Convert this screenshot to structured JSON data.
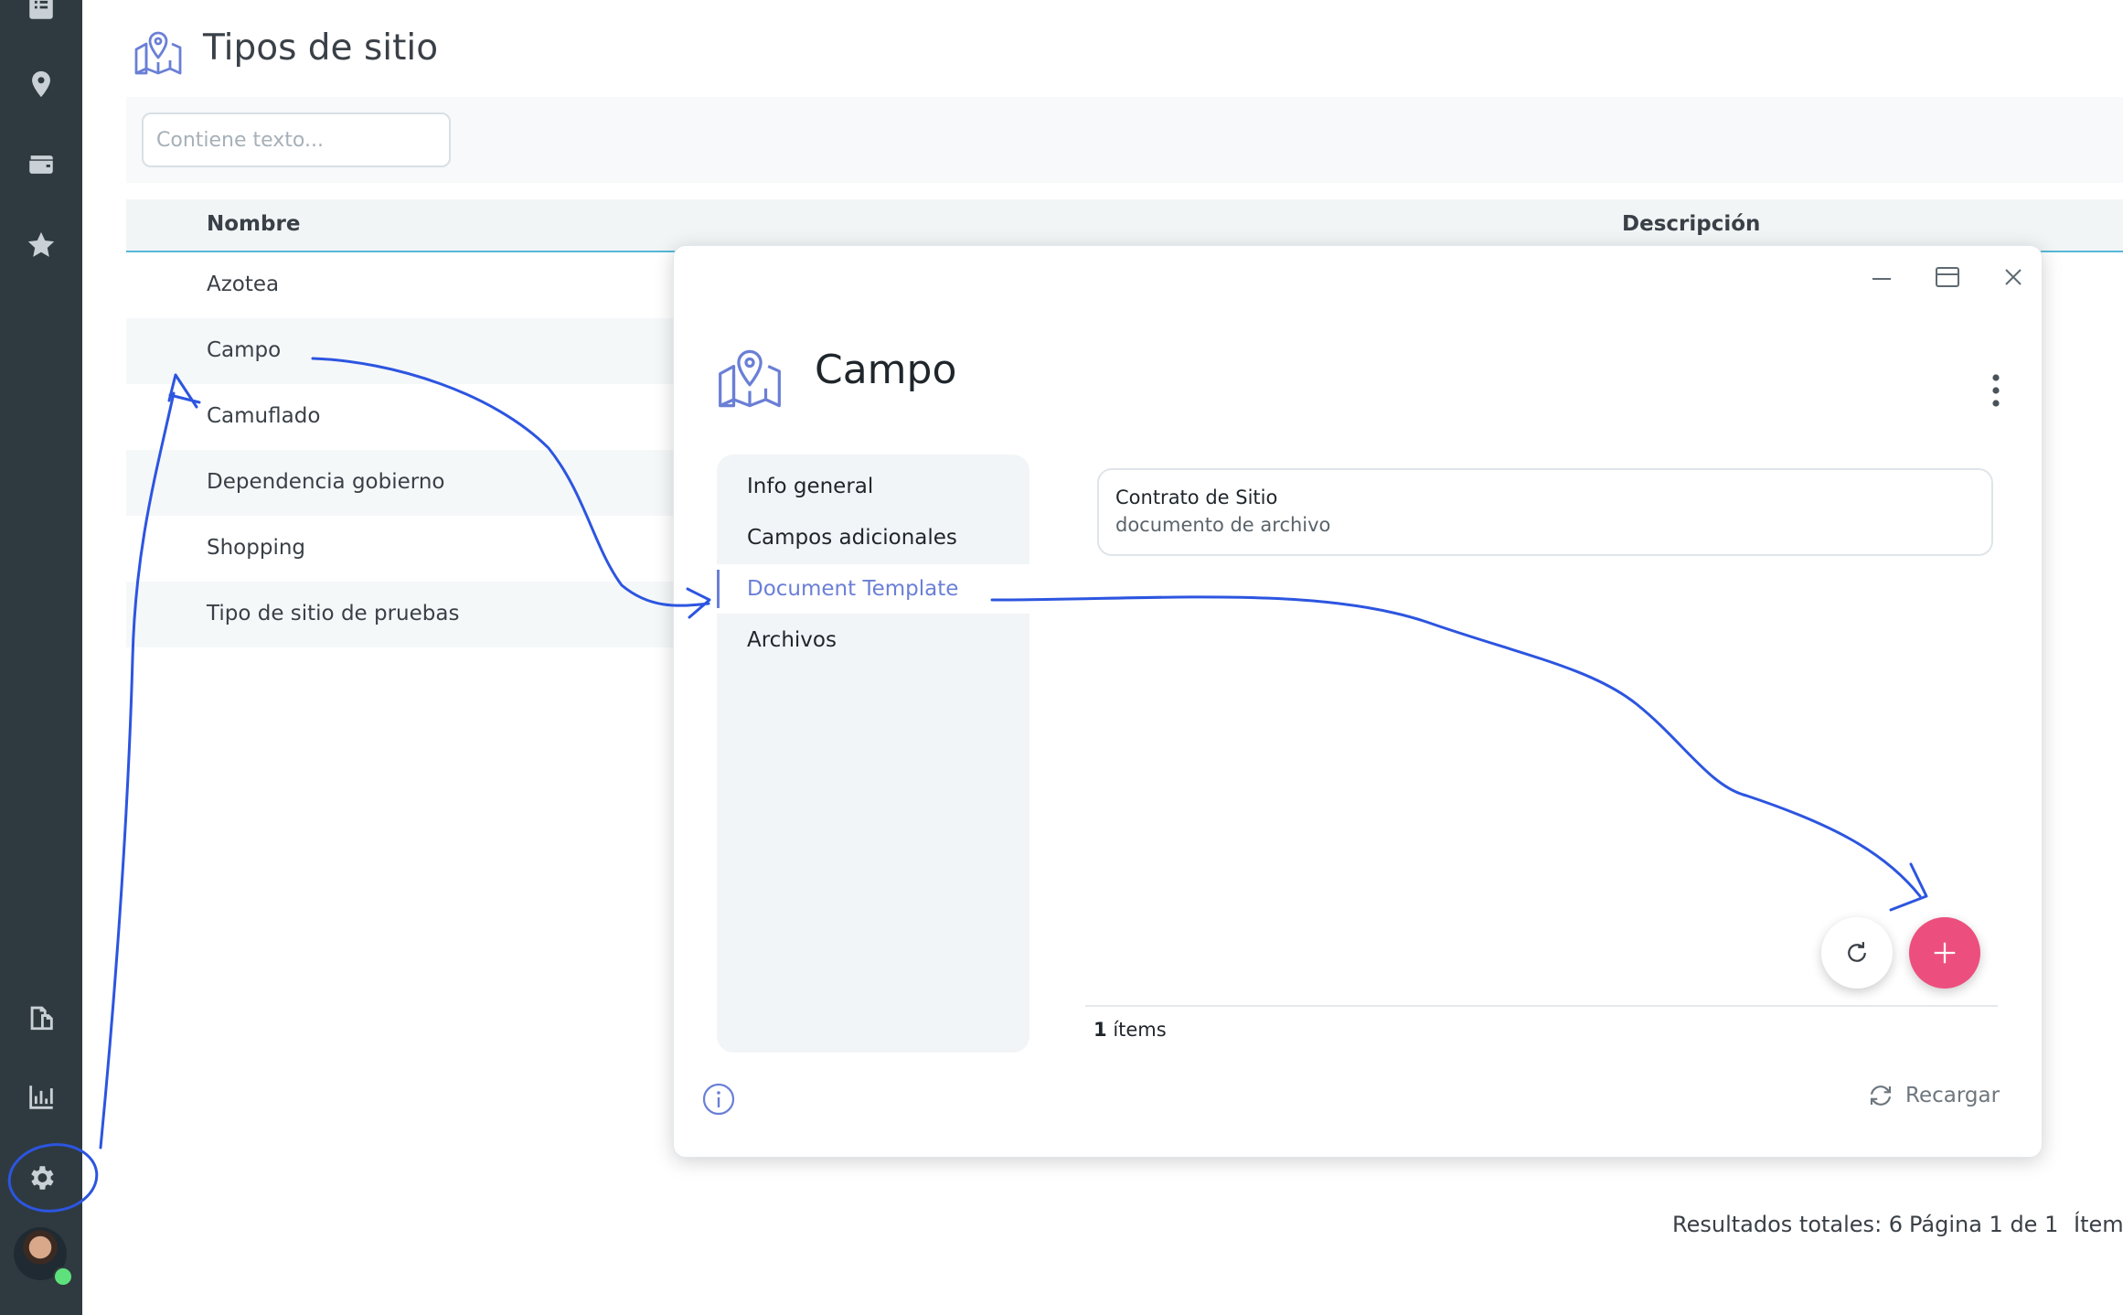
{
  "sidebar": {
    "icons": [
      "list-icon",
      "location-pin-icon",
      "wallet-icon",
      "star-icon",
      "documents-icon",
      "bar-chart-icon",
      "gear-icon"
    ]
  },
  "page": {
    "title": "Tipos de sitio",
    "search_placeholder": "Contiene texto...",
    "columns": [
      "Nombre",
      "Descripción"
    ],
    "rows": [
      "Azotea",
      "Campo",
      "Camuflado",
      "Dependencia gobierno",
      "Shopping",
      "Tipo de sitio de pruebas"
    ],
    "footer": {
      "total": "Resultados totales: 6",
      "page": "Página 1 de 1",
      "items": "Ítems"
    }
  },
  "modal": {
    "title": "Campo",
    "nav": [
      "Info general",
      "Campos adicionales",
      "Document Template",
      "Archivos"
    ],
    "active_nav": "Document Template",
    "card": {
      "title": "Contrato de Sitio",
      "subtitle": "documento de archivo"
    },
    "items_count": "1",
    "items_label": "ítems",
    "reload_label": "Recargar"
  },
  "colors": {
    "sidebar": "#2e3a3f",
    "accent": "#6a7fd6",
    "fab": "#ec4f7e",
    "annotation": "#2c55e0"
  }
}
